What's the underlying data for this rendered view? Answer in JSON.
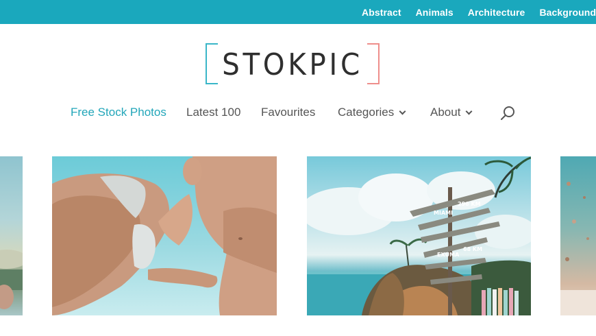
{
  "topbar": {
    "categories": [
      {
        "label": "Abstract"
      },
      {
        "label": "Animals"
      },
      {
        "label": "Architecture"
      },
      {
        "label": "Backgrounds"
      }
    ],
    "background_color": "#1aa8bd"
  },
  "logo": {
    "text": "STOKPIC",
    "left_bracket_color": "#39b6c8",
    "right_bracket_color": "#ee8e8b"
  },
  "nav": {
    "items": [
      {
        "label": "Free Stock Photos",
        "active": true
      },
      {
        "label": "Latest 100"
      },
      {
        "label": "Favourites"
      },
      {
        "label": "Categories",
        "dropdown": true
      },
      {
        "label": "About",
        "dropdown": true
      }
    ],
    "search_icon": "search-icon",
    "active_color": "#22a6b9"
  },
  "gallery": {
    "photos": [
      {
        "subject": "partial-beach-photo"
      },
      {
        "subject": "couple-low-angle-sky"
      },
      {
        "subject": "signpost-beach-sky"
      },
      {
        "subject": "partial-beach-photo"
      }
    ]
  },
  "signpost": {
    "signs": [
      "MIAMI",
      "296 KM",
      "EXUMA",
      "68 KM"
    ]
  }
}
